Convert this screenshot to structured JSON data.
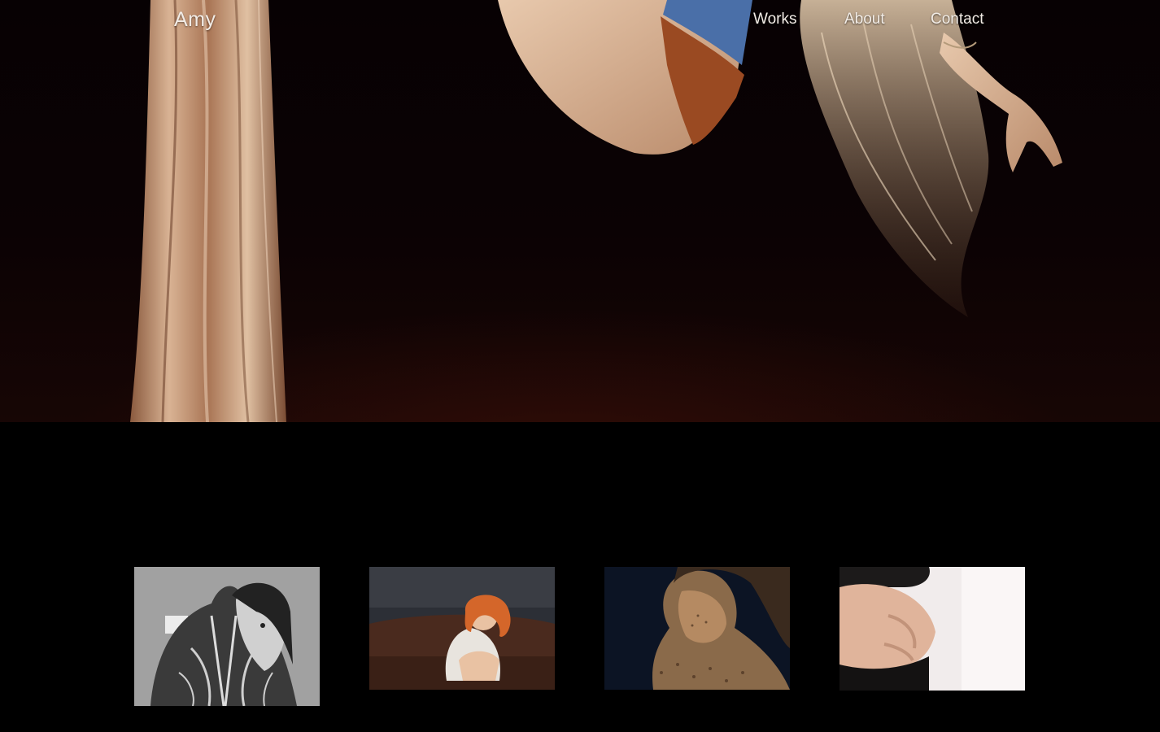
{
  "site": {
    "brand": "Amy"
  },
  "nav": {
    "items": [
      {
        "label": "Works"
      },
      {
        "label": "About"
      },
      {
        "label": "Contact"
      }
    ]
  },
  "hero": {
    "image": "aerial-silk-performer-photo"
  },
  "gallery": {
    "items": [
      {
        "image": "tattooed-back-couple-bw-photo"
      },
      {
        "image": "redhead-laughing-on-sofa-photo"
      },
      {
        "image": "freckled-woman-portrait-photo"
      },
      {
        "image": "pregnant-belly-photo"
      }
    ]
  },
  "colors": {
    "background": "#000000",
    "text": "#f2ece6",
    "silk": "#c49a78"
  }
}
